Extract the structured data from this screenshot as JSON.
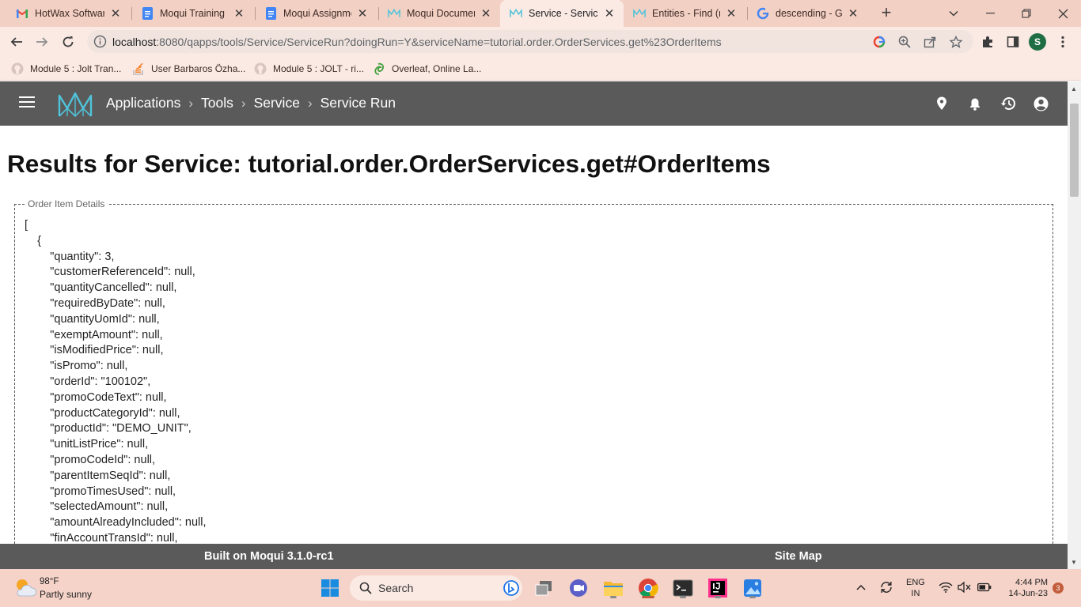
{
  "browser": {
    "tabs": [
      {
        "title": "HotWax Software",
        "icon": "gmail-icon"
      },
      {
        "title": "Moqui Training S",
        "icon": "google-docs-icon"
      },
      {
        "title": "Moqui Assignme",
        "icon": "google-docs-icon"
      },
      {
        "title": "Moqui Documen",
        "icon": "moqui-icon"
      },
      {
        "title": "Service - Service",
        "icon": "moqui-icon",
        "active": true
      },
      {
        "title": "Entities - Find (m",
        "icon": "moqui-icon"
      },
      {
        "title": "descending - Go",
        "icon": "google-icon"
      }
    ],
    "address": {
      "host": "localhost",
      "rest": ":8080/qapps/tools/Service/ServiceRun?doingRun=Y&serviceName=tutorial.order.OrderServices.get%23OrderItems"
    },
    "profile_initial": "S",
    "bookmarks": [
      {
        "label": "Module 5 : Jolt Tran...",
        "icon": "github-icon"
      },
      {
        "label": "User Barbaros Özha...",
        "icon": "stackoverflow-icon"
      },
      {
        "label": "Module 5 : JOLT - ri...",
        "icon": "github-icon"
      },
      {
        "label": "Overleaf, Online La...",
        "icon": "overleaf-icon"
      }
    ]
  },
  "app": {
    "breadcrumbs": [
      "Applications",
      "Tools",
      "Service",
      "Service Run"
    ],
    "page_title": "Results for Service: tutorial.order.OrderServices.get#OrderItems",
    "fieldset_legend": "Order Item Details",
    "json_lines": [
      "[",
      "    {",
      "        \"quantity\": 3,",
      "        \"customerReferenceId\": null,",
      "        \"quantityCancelled\": null,",
      "        \"requiredByDate\": null,",
      "        \"quantityUomId\": null,",
      "        \"exemptAmount\": null,",
      "        \"isModifiedPrice\": null,",
      "        \"isPromo\": null,",
      "        \"orderId\": \"100102\",",
      "        \"promoCodeText\": null,",
      "        \"productCategoryId\": null,",
      "        \"productId\": \"DEMO_UNIT\",",
      "        \"unitListPrice\": null,",
      "        \"promoCodeId\": null,",
      "        \"parentItemSeqId\": null,",
      "        \"promoTimesUsed\": null,",
      "        \"selectedAmount\": null,",
      "        \"amountAlreadyIncluded\": null,",
      "        \"finAccountTransId\": null,"
    ],
    "footer": {
      "built_on": "Built on Moqui 3.1.0-rc1",
      "site_map": "Site Map"
    }
  },
  "taskbar": {
    "weather_temp": "98°F",
    "weather_desc": "Partly sunny",
    "search_label": "Search",
    "lang_line1": "ENG",
    "lang_line2": "IN",
    "time": "4:44 PM",
    "date": "14-Jun-23",
    "notification_count": "3"
  },
  "colors": {
    "tabstrip": "#f3d0c4",
    "header": "#5a5a5a",
    "moqui_logo": "#4fc3d9"
  }
}
